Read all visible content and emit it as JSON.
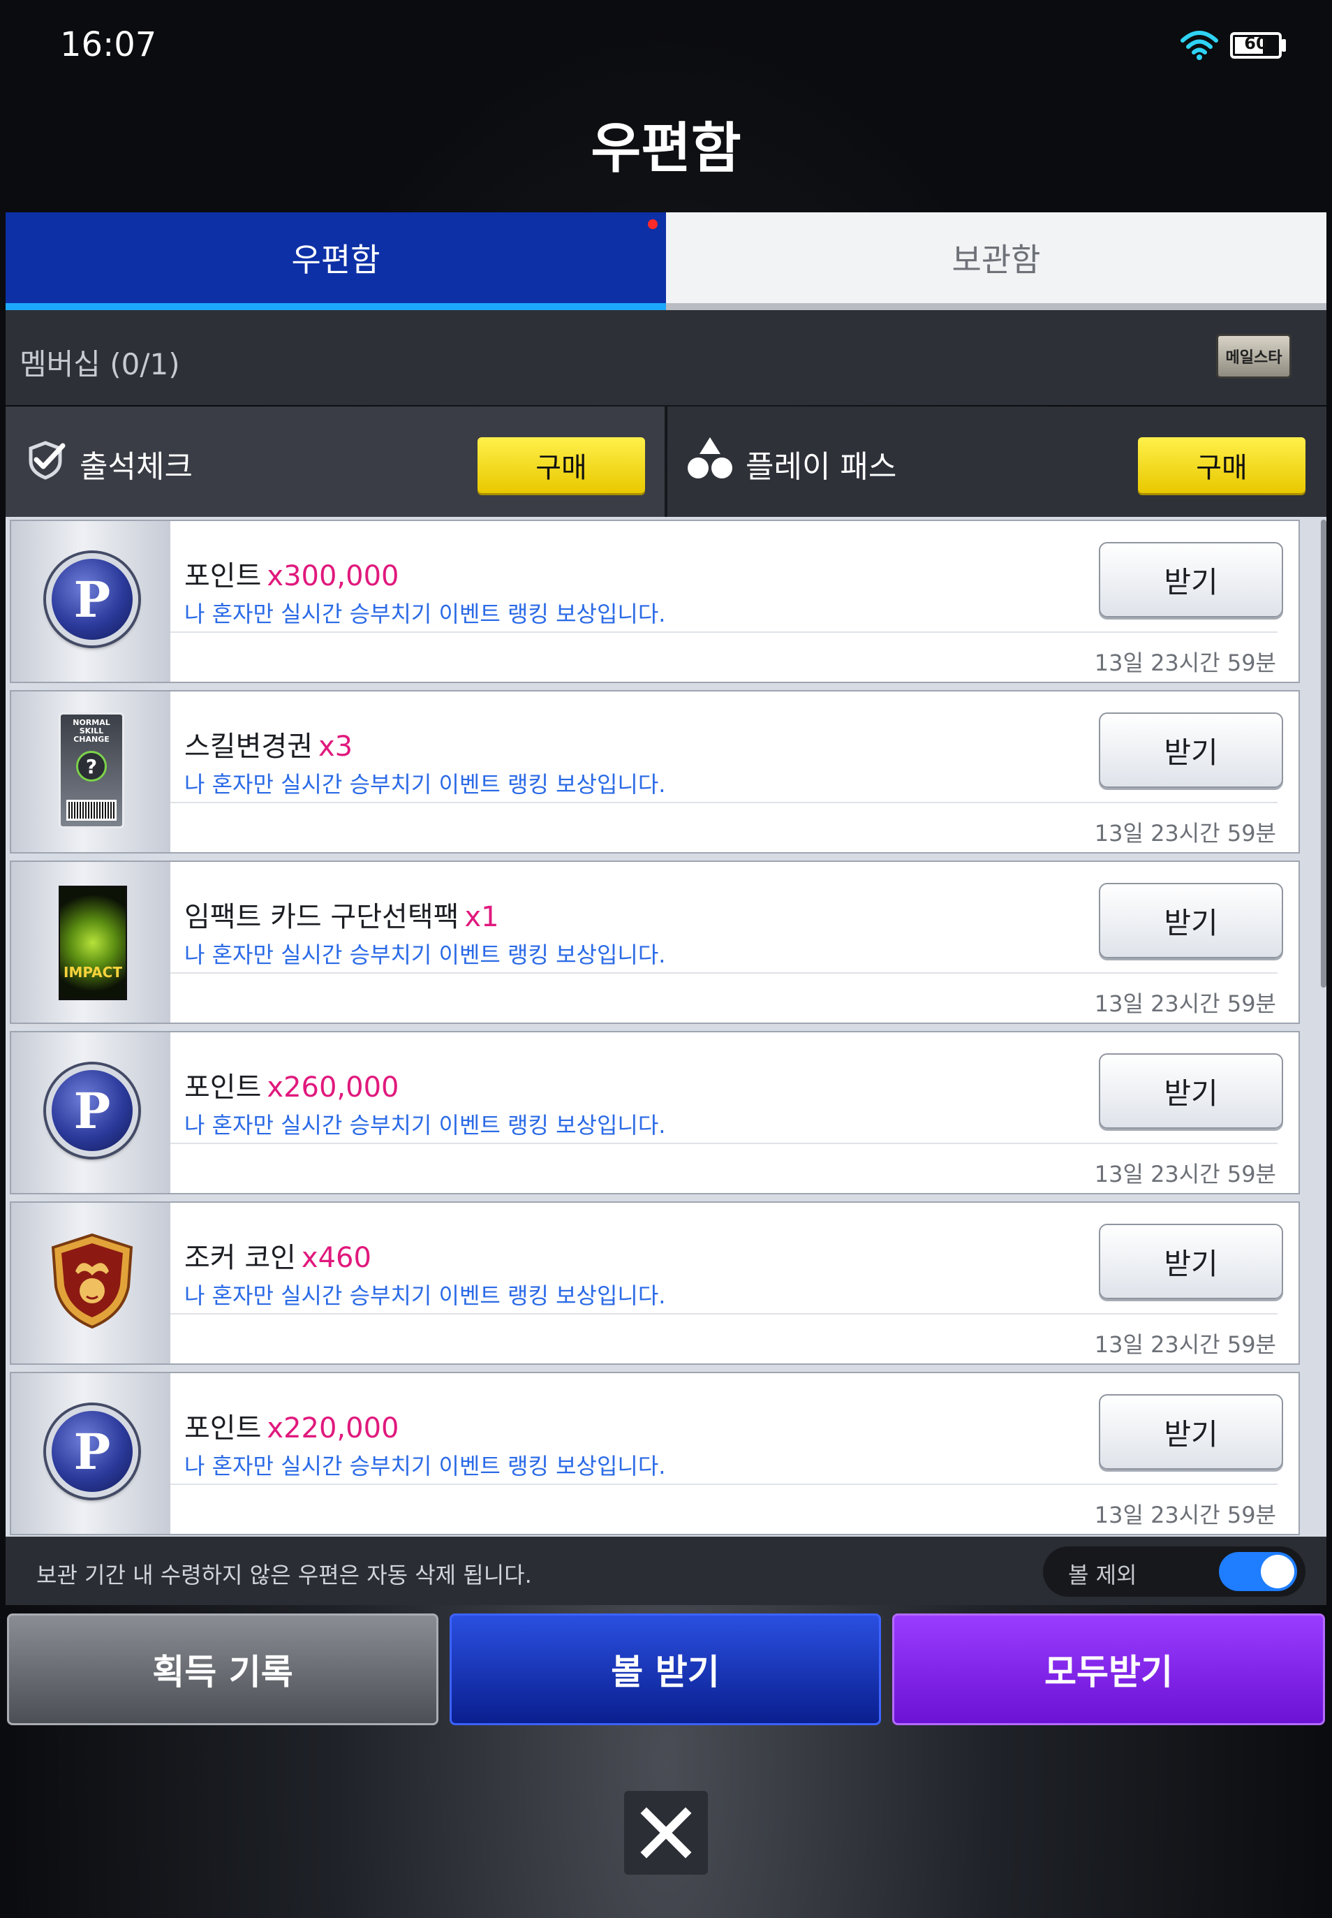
{
  "status": {
    "time": "16:07",
    "battery": "60"
  },
  "page_title": "우편함",
  "tabs": [
    {
      "label": "우편함"
    },
    {
      "label": "보관함"
    }
  ],
  "membership": {
    "label": "멤버십 (0/1)",
    "badge": "메일스타"
  },
  "purchases": [
    {
      "label": "출석체크",
      "button": "구매"
    },
    {
      "label": "플레이 패스",
      "button": "구매"
    }
  ],
  "mails": [
    {
      "icon": "point-coin-icon",
      "name": "포인트",
      "qty": "x300,000",
      "desc": "나 혼자만 실시간 승부치기 이벤트 랭킹 보상입니다.",
      "button": "받기",
      "time": "13일 23시간 59분"
    },
    {
      "icon": "skill-change-ticket-icon",
      "name": "스킬변경권",
      "qty": "x3",
      "desc": "나 혼자만 실시간 승부치기 이벤트 랭킹 보상입니다.",
      "button": "받기",
      "time": "13일 23시간 59분"
    },
    {
      "icon": "impact-card-pack-icon",
      "name": "임팩트 카드 구단선택팩",
      "qty": "x1",
      "desc": "나 혼자만 실시간 승부치기 이벤트 랭킹 보상입니다.",
      "button": "받기",
      "time": "13일 23시간 59분"
    },
    {
      "icon": "point-coin-icon",
      "name": "포인트",
      "qty": "x260,000",
      "desc": "나 혼자만 실시간 승부치기 이벤트 랭킹 보상입니다.",
      "button": "받기",
      "time": "13일 23시간 59분"
    },
    {
      "icon": "joker-coin-icon",
      "name": "조커 코인",
      "qty": "x460",
      "desc": "나 혼자만 실시간 승부치기 이벤트 랭킹 보상입니다.",
      "button": "받기",
      "time": "13일 23시간 59분"
    },
    {
      "icon": "point-coin-icon",
      "name": "포인트",
      "qty": "x220,000",
      "desc": "나 혼자만 실시간 승부치기 이벤트 랭킹 보상입니다.",
      "button": "받기",
      "time": "13일 23시간 59분"
    }
  ],
  "footer": {
    "notice": "보관 기간 내 수령하지 않은 우편은 자동 삭제 됩니다.",
    "toggle_label": "볼 제외",
    "toggle_on": true
  },
  "actions": [
    {
      "label": "획득 기록"
    },
    {
      "label": "볼 받기"
    },
    {
      "label": "모두받기"
    }
  ],
  "colors": {
    "primary_blue": "#0d30a6",
    "accent_purple": "#7a1ee6",
    "buy_yellow": "#f5dc14",
    "qty_pink": "#e0197d",
    "desc_blue": "#2a6ae6"
  }
}
